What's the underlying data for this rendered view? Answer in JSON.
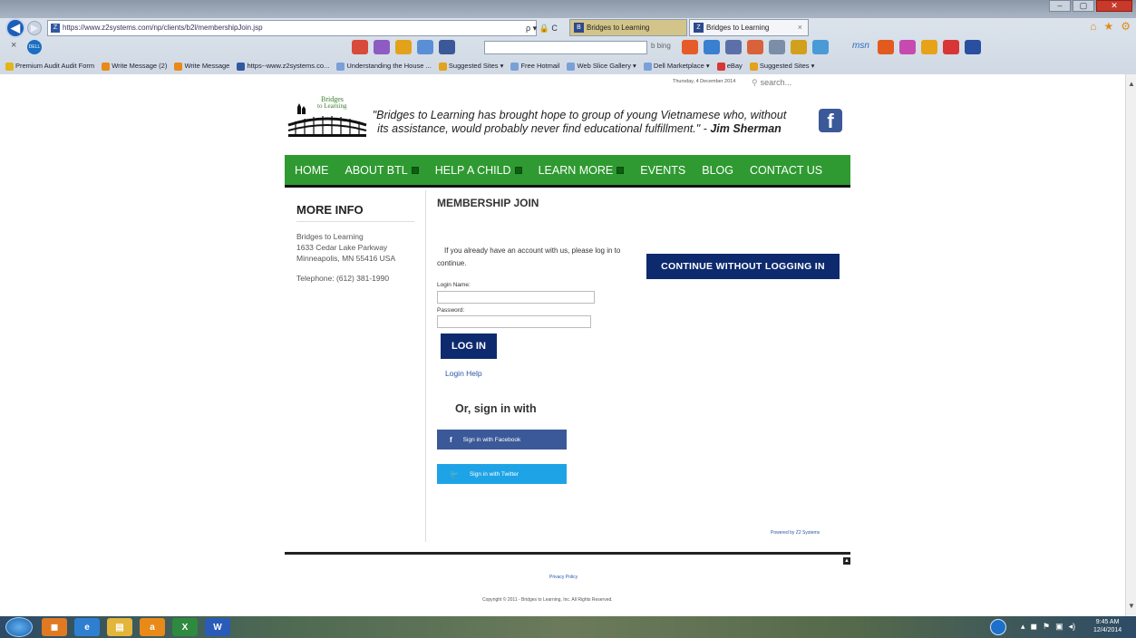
{
  "browser": {
    "url": "https://www.z2systems.com/np/clients/b2l/membershipJoin.jsp",
    "search_hint": "ρ ▾ 🔒 C",
    "tabs": [
      {
        "label": "Bridges to Learning"
      },
      {
        "label": "Bridges to Learning",
        "close": "×"
      }
    ],
    "bing_label": "b bing",
    "msn_label": "msn",
    "favorites": [
      "Premium Audit Audit Form",
      "Write Message (2)",
      "Write Message",
      "https--www.z2systems.co...",
      "Understanding the House ...",
      "Suggested Sites ▾",
      "Free Hotmail",
      "Web Slice Gallery ▾",
      "Dell Marketplace ▾",
      "eBay",
      "Suggested Sites ▾"
    ],
    "toolbar_close": "×",
    "dell_label": "DELL"
  },
  "header": {
    "date": "Thursday, 4 December 2014",
    "search_placeholder": "search...",
    "logo_text_1": "Bridges",
    "logo_text_2": "to Learning",
    "quote": "\"Bridges to Learning has brought hope to group of young Vietnamese who, without its assistance, would probably never find educational fulfillment.\" - ",
    "quote_author": "Jim Sherman",
    "facebook_glyph": "f"
  },
  "nav": {
    "items": [
      {
        "label": "HOME"
      },
      {
        "label": "ABOUT BTL"
      },
      {
        "label": "HELP A CHILD"
      },
      {
        "label": "LEARN MORE"
      },
      {
        "label": "EVENTS"
      },
      {
        "label": "BLOG"
      },
      {
        "label": "CONTACT US"
      }
    ]
  },
  "sidebar": {
    "title": "MORE INFO",
    "org": "Bridges to Learning",
    "street": "1633 Cedar Lake Parkway",
    "city": "Minneapolis, MN 55416 USA",
    "phone": "Telephone: (612) 381-1990"
  },
  "main": {
    "title": "MEMBERSHIP JOIN",
    "login_note": "If you already have an account with us, please log in to continue.",
    "continue_label": "CONTINUE WITHOUT LOGGING IN",
    "login_name_label": "Login Name:",
    "password_label": "Password:",
    "login_name_value": "",
    "password_value": "",
    "login_button": "LOG IN",
    "login_help": "Login Help",
    "or_signin": "Or, sign in with",
    "facebook_label": "Sign in with Facebook",
    "twitter_label": "Sign in with Twitter",
    "facebook_glyph": "f",
    "twitter_glyph": "🐦",
    "powered_by": "Powered by Z2 Systems"
  },
  "footer": {
    "privacy": "Privacy Policy",
    "copyright": "Copyright © 2011 - Bridges to Learning, Inc. All Rights Reserved."
  },
  "taskbar": {
    "time": "9:45 AM",
    "date": "12/4/2014",
    "apps": [
      {
        "name": "ie",
        "glyph": "e"
      },
      {
        "name": "explorer",
        "glyph": "▤"
      },
      {
        "name": "amazon",
        "glyph": "a"
      },
      {
        "name": "excel",
        "glyph": "X"
      },
      {
        "name": "word",
        "glyph": "W"
      }
    ]
  },
  "colors": {
    "nav_green": "#2f9a31",
    "button_navy": "#0e2a6e",
    "facebook": "#3b5998",
    "twitter": "#1ea4e6",
    "link_blue": "#2a56a8"
  }
}
